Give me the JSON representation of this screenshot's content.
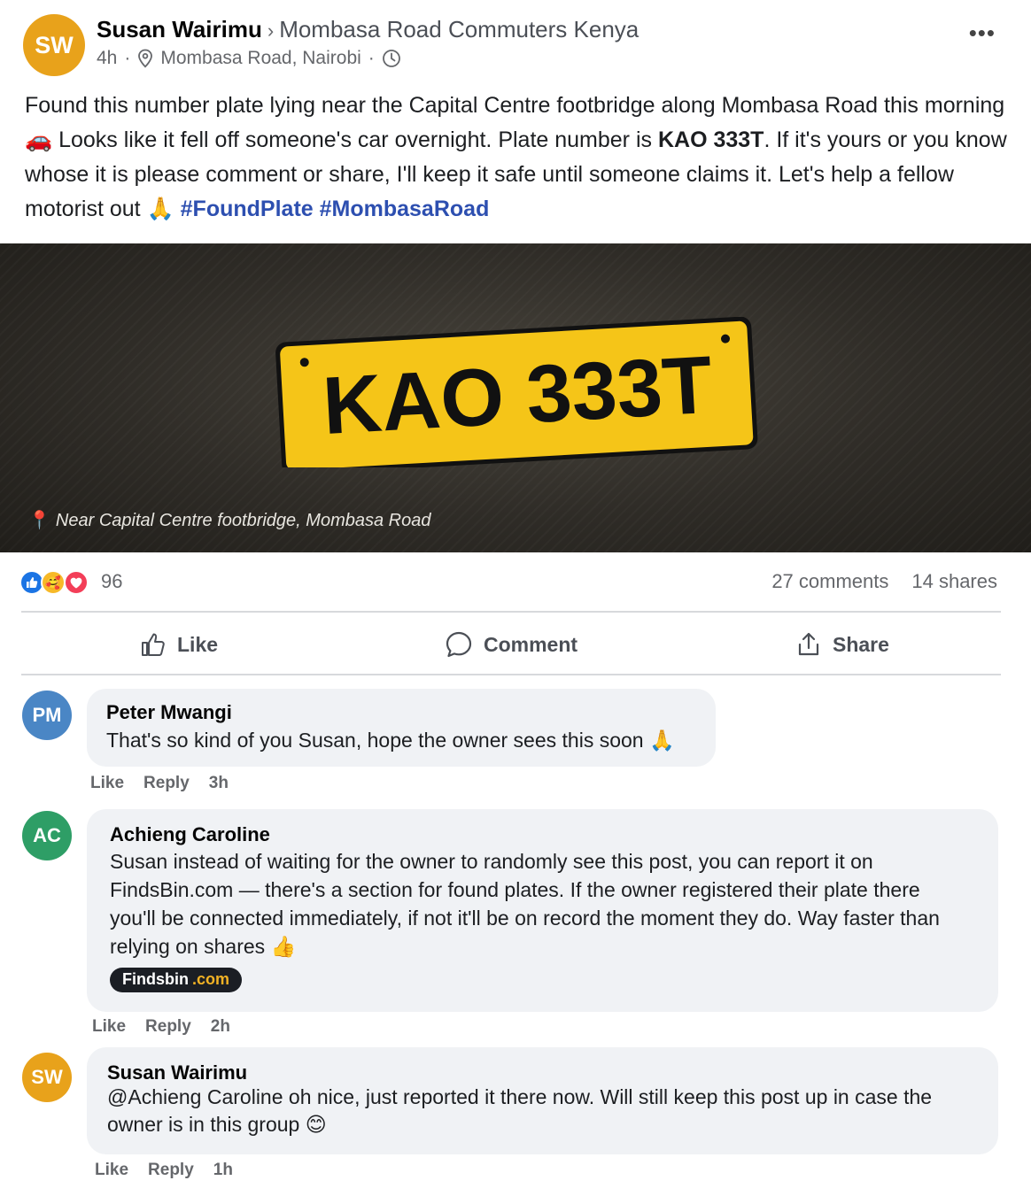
{
  "post": {
    "author": "Susan Wairimu",
    "author_initials": "SW",
    "group": "Mombasa Road Commuters Kenya",
    "time": "4h",
    "location": "Mombasa Road, Nairobi",
    "text_1": "Found this number plate lying near the Capital Centre footbridge along Mombasa Road this morning ",
    "emoji_car": "🚗",
    "text_2": " Looks like it fell off someone's car overnight. Plate number is ",
    "plate_bold": "KAO 333T",
    "text_3": ". If it's yours or you know whose it is please comment or share, I'll keep it safe until someone claims it. Let's help a fellow motorist out ",
    "emoji_pray": "🙏",
    "hashtags": [
      "#FoundPlate",
      "#MombasaRoad"
    ]
  },
  "photo": {
    "plate_text": "KAO 333T",
    "caption": "Near Capital Centre footbridge, Mombasa Road",
    "plate_color": "#f5c518"
  },
  "stats": {
    "reactions": "96",
    "comments": "27 comments",
    "shares": "14 shares"
  },
  "actions": {
    "like": "Like",
    "comment": "Comment",
    "share": "Share"
  },
  "comments": [
    {
      "initials": "PM",
      "avatar_color": "#4a86c5",
      "name": "Peter Mwangi",
      "text": "That's so kind of you Susan, hope the owner sees this soon 🙏",
      "like": "Like",
      "reply": "Reply",
      "time": "3h"
    },
    {
      "initials": "AC",
      "avatar_color": "#2e9e66",
      "name": "Achieng Caroline",
      "text": "Susan instead of waiting for the owner to randomly see this post, you can report it on FindsBin.com — there's a section for found plates. If the owner registered their plate there you'll be connected immediately, if not it'll be on record the moment they do. Way faster than relying on shares 👍",
      "badge_name": "Findsbin",
      "badge_domain": ".com",
      "like": "Like",
      "reply": "Reply",
      "time": "2h"
    },
    {
      "initials": "SW",
      "avatar_color": "#e8a21b",
      "name": "Susan Wairimu",
      "text": "@Achieng Caroline oh nice, just reported it there now. Will still keep this post up in case the owner is in this group 😊",
      "like": "Like",
      "reply": "Reply",
      "time": "1h"
    }
  ],
  "colors": {
    "hashtag": "#2d4fb0",
    "like_reaction": "#1b74e4",
    "love_reaction": "#f33e58",
    "bubble_bg": "#f0f2f5"
  }
}
